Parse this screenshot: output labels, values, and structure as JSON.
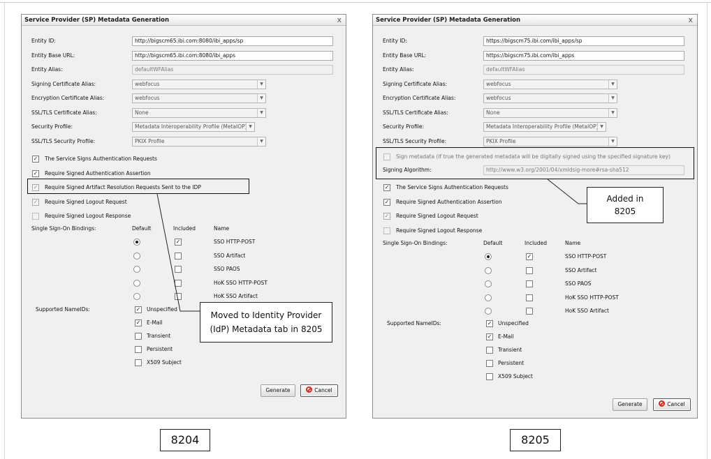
{
  "left": {
    "title": "Service Provider (SP) Metadata Generation",
    "close": "x",
    "fields": [
      {
        "label": "Entity ID:",
        "value": "http://bigscm65.ibi.com:8080/ibi_apps/sp"
      },
      {
        "label": "Entity Base URL:",
        "value": "http://bigscm65.ibi.com:8080/ibi_apps"
      },
      {
        "label": "Entity Alias:",
        "value": "defaultWFAlias"
      },
      {
        "label": "Signing Certificate Alias:",
        "value": "webfocus"
      },
      {
        "label": "Encryption Certificate Alias:",
        "value": "webfocus"
      },
      {
        "label": "SSL/TLS Certificate Alias:",
        "value": "None"
      },
      {
        "label": "Security Profile:",
        "value": "Metadata Interoperability Profile (MetaIOP)"
      },
      {
        "label": "SSL/TLS Security Profile:",
        "value": "PKIX Profile"
      }
    ],
    "options": [
      {
        "label": "The Service Signs Authentication Requests",
        "checked": true
      },
      {
        "label": "Require Signed Authentication Assertion",
        "checked": true
      },
      {
        "label": "Require Signed Artifact Resolution Requests Sent to the IDP",
        "checked": true
      },
      {
        "label": "Require Signed Logout Request",
        "checked": true
      },
      {
        "label": "Require Signed Logout Response",
        "checked": false
      }
    ],
    "sso_label": "Single Sign-On Bindings:",
    "supported_label": "Supported NameIDs:",
    "generate": "Generate",
    "cancel": "Cancel",
    "callout": "Moved to Identity Provider\n(IdP) Metadata tab in 8205",
    "version": "8204"
  },
  "right": {
    "title": "Service Provider (SP) Metadata Generation",
    "close": "x",
    "fields": [
      {
        "label": "Entity ID:",
        "value": "https://bigscm75.ibi.com/ibi_apps/sp"
      },
      {
        "label": "Entity Base URL:",
        "value": "https://bigscm75.ibi.com/ibi_apps"
      },
      {
        "label": "Entity Alias:",
        "value": "defaultWFAlias"
      },
      {
        "label": "Signing Certificate Alias:",
        "value": "webfocus"
      },
      {
        "label": "Encryption Certificate Alias:",
        "value": "webfocus"
      },
      {
        "label": "SSL/TLS Certificate Alias:",
        "value": "None"
      },
      {
        "label": "Security Profile:",
        "value": "Metadata Interoperability Profile (MetaIOP)"
      },
      {
        "label": "SSL/TLS Security Profile:",
        "value": "PKIX Profile"
      }
    ],
    "sign_metadata": "Sign metadata (if true the generated metadata will be digitally signed using the specified signature key)",
    "signing_algorithm_label": "Signing Algorithm:",
    "signing_algorithm_value": "http://www.w3.org/2001/04/xmldsig-more#rsa-sha512",
    "options": [
      {
        "label": "The Service Signs Authentication Requests",
        "checked": true
      },
      {
        "label": "Require Signed Authentication Assertion",
        "checked": true
      },
      {
        "label": "Require Signed Logout Request",
        "checked": true
      },
      {
        "label": "Require Signed Logout Response",
        "checked": false
      }
    ],
    "sso_label": "Single Sign-On Bindings:",
    "supported_label": "Supported NameIDs:",
    "generate": "Generate",
    "cancel": "Cancel",
    "callout": "Added in\n8205",
    "version": "8205"
  },
  "bindings": {
    "headers": {
      "default": "Default",
      "included": "Included",
      "name": "Name"
    },
    "rows": [
      {
        "name": "SSO HTTP-POST",
        "default": true,
        "included": true
      },
      {
        "name": "SSO Artifact",
        "default": false,
        "included": false
      },
      {
        "name": "SSO PAOS",
        "default": false,
        "included": false
      },
      {
        "name": "HoK SSO HTTP-POST",
        "default": false,
        "included": false
      },
      {
        "name": "HoK SSO Artifact",
        "default": false,
        "included": false
      }
    ]
  },
  "nameids": [
    {
      "label": "Unspecified",
      "checked": true
    },
    {
      "label": "E-Mail",
      "checked": true
    },
    {
      "label": "Transient",
      "checked": false
    },
    {
      "label": "Persistent",
      "checked": false
    },
    {
      "label": "X509 Subject",
      "checked": false
    }
  ],
  "colors": {
    "cancel_icon": "#d42a1e",
    "dialog_bg": "#f0f0f0"
  }
}
